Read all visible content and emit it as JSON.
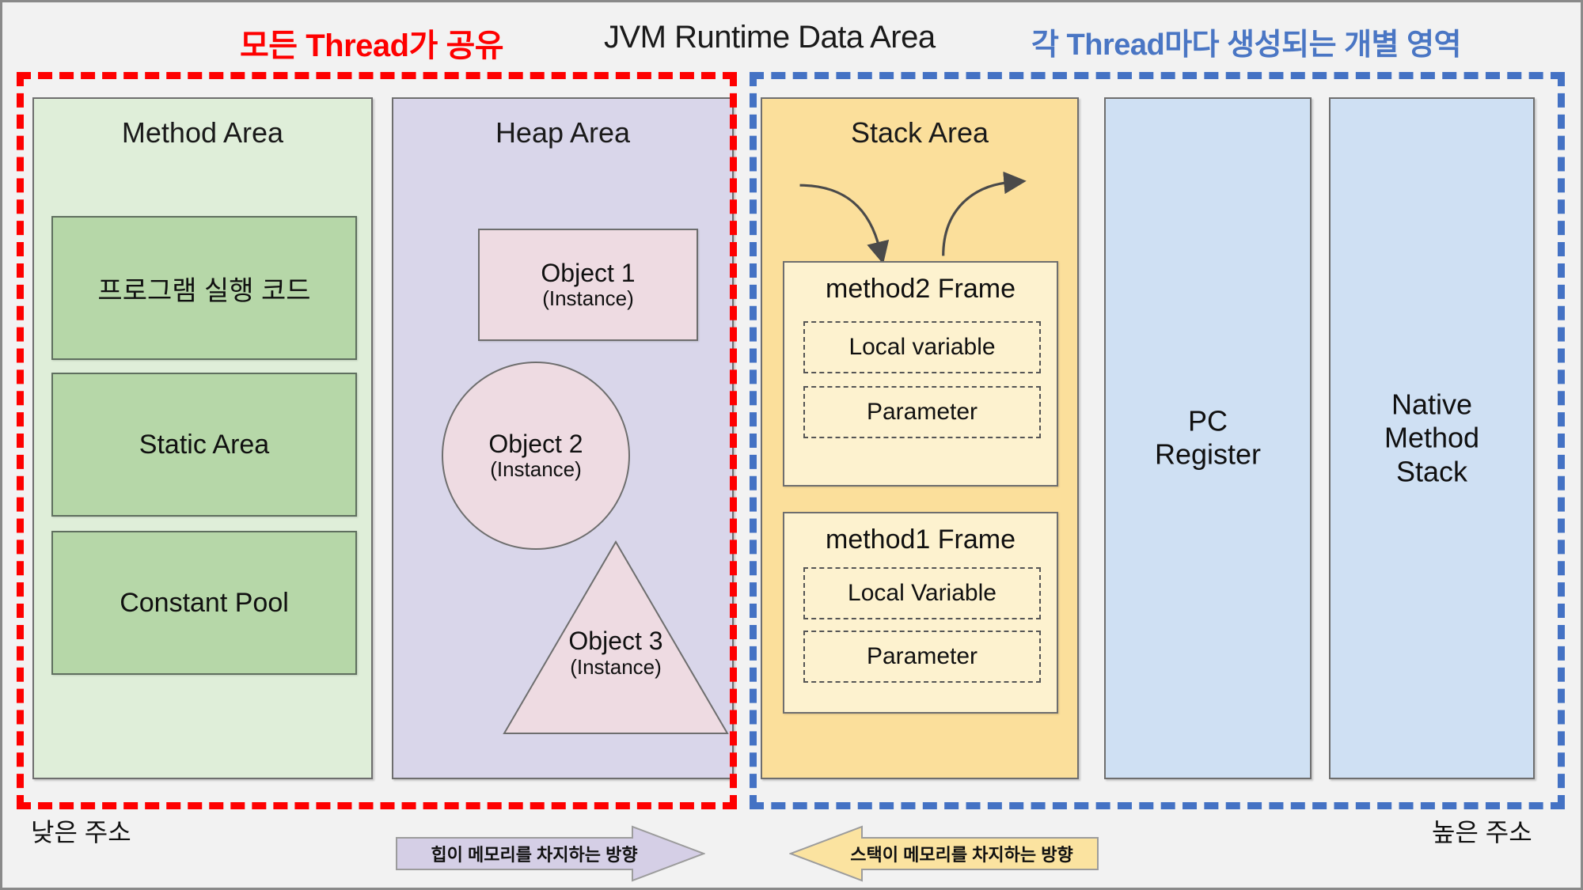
{
  "header": {
    "shared_caption": "모든 Thread가 공유",
    "title": "JVM Runtime Data Area",
    "per_thread_caption": "각 Thread마다 생성되는 개별 영역"
  },
  "colors": {
    "shared_border": "#FE0000",
    "per_thread_border": "#4472C4",
    "method_area_bg": "#DFEED9",
    "heap_area_bg": "#D9D6EA",
    "stack_area_bg": "#FBDF9B",
    "register_bg": "#CFE0F3",
    "object_bg": "#EEDBE2",
    "frame_bg": "#FDF2CF",
    "method_sub_bg": "#B6D7A8"
  },
  "regions": {
    "method_area": {
      "title": "Method Area",
      "boxes": [
        {
          "label": "프로그램 실행 코드"
        },
        {
          "label": "Static Area"
        },
        {
          "label": "Constant Pool"
        }
      ]
    },
    "heap_area": {
      "title": "Heap Area",
      "objects": [
        {
          "name": "Object 1",
          "kind": "(Instance)",
          "shape": "rectangle"
        },
        {
          "name": "Object 2",
          "kind": "(Instance)",
          "shape": "circle"
        },
        {
          "name": "Object 3",
          "kind": "(Instance)",
          "shape": "triangle"
        }
      ]
    },
    "stack_area": {
      "title": "Stack Area",
      "push_arrow": "push-arrow",
      "pop_arrow": "pop-arrow",
      "frames": [
        {
          "title": "method2 Frame",
          "slots": [
            "Local variable",
            "Parameter"
          ]
        },
        {
          "title": "method1 Frame",
          "slots": [
            "Local Variable",
            "Parameter"
          ]
        }
      ]
    },
    "pc_register": {
      "title": "PC\nRegister",
      "line1": "PC",
      "line2": "Register"
    },
    "native_method_stack": {
      "line1": "Native",
      "line2": "Method",
      "line3": "Stack"
    }
  },
  "footer": {
    "low_address": "낮은 주소",
    "high_address": "높은 주소",
    "heap_direction": "힙이 메모리를 차지하는 방향",
    "stack_direction": "스택이 메모리를 차지하는 방향"
  }
}
